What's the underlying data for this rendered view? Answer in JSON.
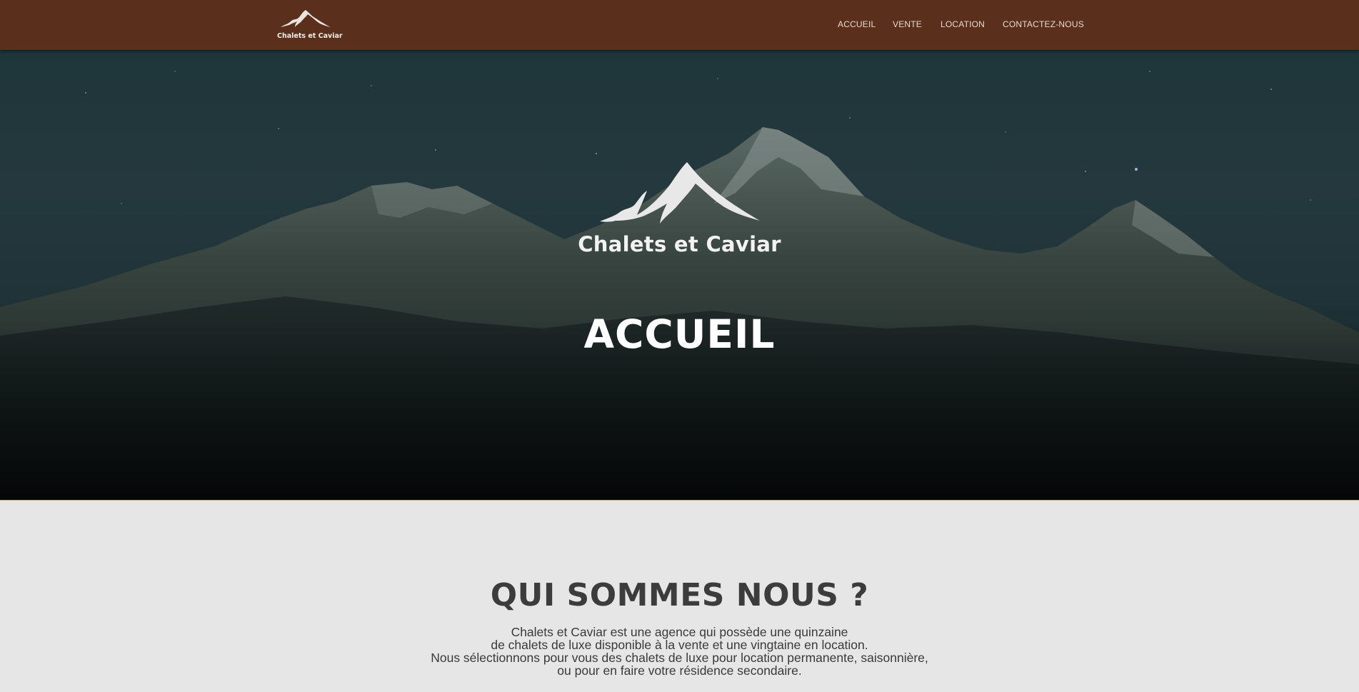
{
  "header": {
    "brand_name": "Chalets et Caviar",
    "logo_icon": "mountain-logo-icon",
    "nav": [
      {
        "label": "ACCUEIL"
      },
      {
        "label": "VENTE"
      },
      {
        "label": "LOCATION"
      },
      {
        "label": "CONTACTEZ-NOUS"
      }
    ]
  },
  "hero": {
    "brand_name": "Chalets et Caviar",
    "title": "ACCUEIL",
    "background": "night-mountain-range-photo"
  },
  "about": {
    "title": "QUI SOMMES NOUS ?",
    "lines": [
      "Chalets et Caviar est une agence qui possède une quinzaine",
      "de chalets de luxe disponible à la vente et une vingtaine en location.",
      "Nous sélectionnons pour vous des chalets de luxe pour location permanente, saisonnière,",
      "ou pour en faire votre résidence secondaire."
    ]
  },
  "colors": {
    "header_bg": "#5a301c",
    "nav_text": "#e9d8cf",
    "section_bg": "#e6e6e6",
    "heading_text": "#3c3c3c"
  }
}
